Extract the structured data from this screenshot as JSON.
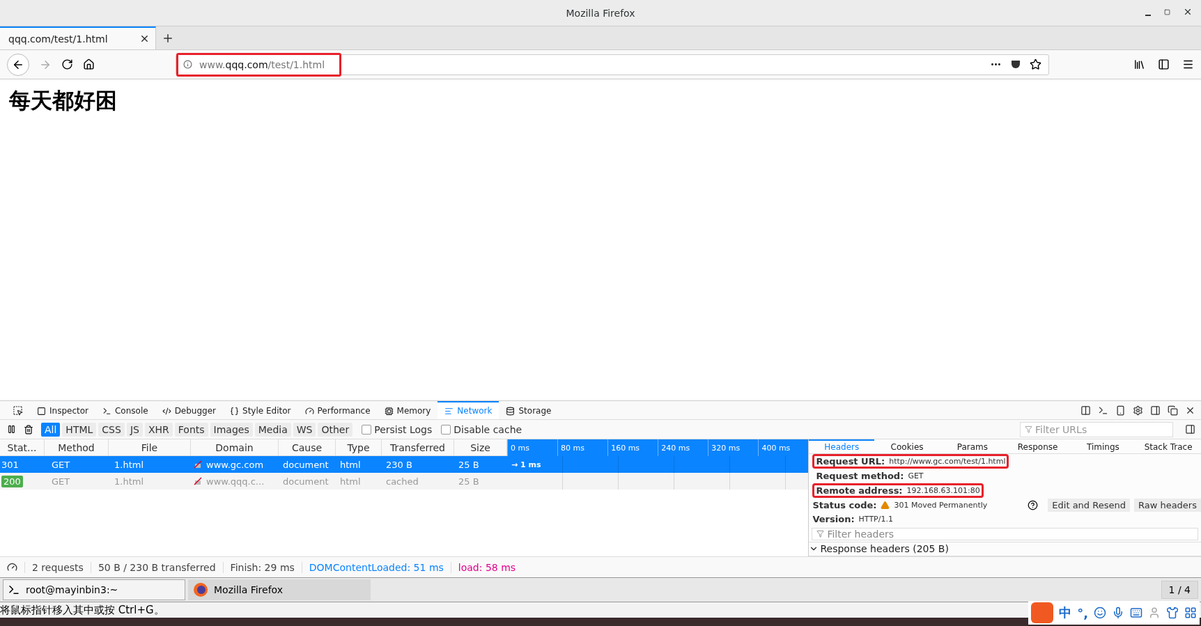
{
  "window": {
    "title": "Mozilla Firefox"
  },
  "tabs": [
    {
      "label": "qqq.com/test/1.html",
      "selected": true
    }
  ],
  "address_bar": {
    "url_parts": [
      {
        "text": "www.",
        "strong": false
      },
      {
        "text": "qqq.com",
        "strong": true
      },
      {
        "text": "/test/1.html",
        "strong": false
      }
    ],
    "highlighted": true
  },
  "page": {
    "heading": "每天都好困"
  },
  "devtools": {
    "tabs": [
      {
        "label": "Inspector",
        "selected": false
      },
      {
        "label": "Console",
        "selected": false
      },
      {
        "label": "Debugger",
        "selected": false
      },
      {
        "label": "Style Editor",
        "selected": false
      },
      {
        "label": "Performance",
        "selected": false
      },
      {
        "label": "Memory",
        "selected": false
      },
      {
        "label": "Network",
        "selected": true
      },
      {
        "label": "Storage",
        "selected": false
      }
    ],
    "filters": [
      {
        "label": "All",
        "selected": true
      },
      {
        "label": "HTML",
        "selected": false
      },
      {
        "label": "CSS",
        "selected": false
      },
      {
        "label": "JS",
        "selected": false
      },
      {
        "label": "XHR",
        "selected": false
      },
      {
        "label": "Fonts",
        "selected": false
      },
      {
        "label": "Images",
        "selected": false
      },
      {
        "label": "Media",
        "selected": false
      },
      {
        "label": "WS",
        "selected": false
      },
      {
        "label": "Other",
        "selected": false
      }
    ],
    "options": [
      {
        "label": "Persist Logs",
        "checked": false
      },
      {
        "label": "Disable cache",
        "checked": false
      }
    ],
    "filter_urls": {
      "placeholder": "Filter URLs"
    },
    "table": {
      "columns": [
        "Stat...",
        "Method",
        "File",
        "Domain",
        "Cause",
        "Type",
        "Transferred",
        "Size"
      ],
      "timeline_ticks": [
        "0 ms",
        "80 ms",
        "160 ms",
        "240 ms",
        "320 ms",
        "400 ms"
      ],
      "rows": [
        {
          "status": "301",
          "method": "GET",
          "file": "1.html",
          "domain": "www.gc.com",
          "cause": "document",
          "type": "html",
          "transferred": "230 B",
          "size": "25 B",
          "timing": "→ 1 ms",
          "selected": true,
          "dimmed": false
        },
        {
          "status": "200",
          "color": "#4cae4c",
          "method": "GET",
          "file": "1.html",
          "domain": "www.qqq.c...",
          "cause": "document",
          "type": "html",
          "transferred": "cached",
          "size": "25 B",
          "selected": false,
          "dimmed": true
        }
      ]
    },
    "details": {
      "tabs": [
        {
          "label": "Headers",
          "selected": true
        },
        {
          "label": "Cookies",
          "selected": false
        },
        {
          "label": "Params",
          "selected": false
        },
        {
          "label": "Response",
          "selected": false
        },
        {
          "label": "Timings",
          "selected": false
        },
        {
          "label": "Stack Trace",
          "selected": false
        }
      ],
      "fields": [
        {
          "label": "Request URL:",
          "value": "http://www.gc.com/test/1.html",
          "highlighted": true
        },
        {
          "label": "Request method:",
          "value": "GET",
          "highlighted": false
        },
        {
          "label": "Remote address:",
          "value": "192.168.63.101:80",
          "highlighted": true
        }
      ],
      "status": {
        "label": "Status code:",
        "value": "301 Moved Permanently"
      },
      "buttons": [
        "Edit and Resend",
        "Raw headers"
      ],
      "version": {
        "label": "Version:",
        "value": "HTTP/1.1"
      },
      "filter_headers": {
        "placeholder": "Filter headers"
      },
      "section": {
        "label": "Response headers (205 B)",
        "expanded": true
      }
    },
    "status_bar": [
      {
        "text": "2 requests"
      },
      {
        "text": "50 B / 230 B transferred"
      },
      {
        "text": "Finish: 29 ms"
      },
      {
        "text": "DOMContentLoaded: 51 ms",
        "color": "#0a84ff"
      },
      {
        "text": "load: 58 ms",
        "color": "#e3008c"
      }
    ]
  },
  "taskbar": {
    "items": [
      {
        "label": "root@mayinbin3:~",
        "selected": false
      },
      {
        "label": "Mozilla Firefox",
        "selected": true
      }
    ],
    "pager": "1 / 4"
  },
  "ime_hint": "将鼠标指针移入其中或按 Ctrl+G。",
  "tray": [
    "中",
    "°,"
  ]
}
